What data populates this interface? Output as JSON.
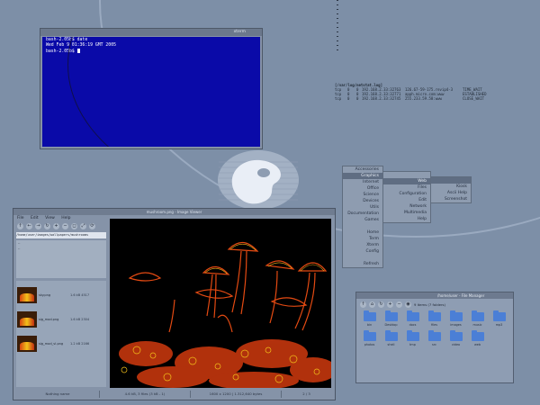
{
  "terminal": {
    "title": "xterm",
    "lines": [
      "bash-2.05b$ date",
      "Wed Feb  9 01:36:19 GMT 2005",
      "bash-2.05b$"
    ]
  },
  "netstat": {
    "header": "[/var/log/netstat.log]",
    "rows": [
      {
        "proto": "tcp",
        "rq": "0",
        "sq": "0",
        "local": "192.168.2.33:32763",
        "foreign": "126.67-59-175.revip4-3",
        "state": "TIME_WAIT"
      },
      {
        "proto": "tcp",
        "rq": "0",
        "sq": "0",
        "local": "192.168.2.33:32771",
        "foreign": "apph.micro.com:www",
        "state": "ESTABLISHED"
      },
      {
        "proto": "tcp",
        "rq": "0",
        "sq": "0",
        "local": "192.168.2.33:32745",
        "foreign": "255.233.59.58:www",
        "state": "CLOSE_WAIT"
      }
    ]
  },
  "menus": {
    "main": [
      "Accessories",
      "Graphics",
      "Internet",
      "Office",
      "Science",
      "Devices",
      "Utils",
      "Documentation",
      "Games",
      "",
      "Home",
      "Term",
      "Xterm",
      "Config",
      "",
      "Refresh"
    ],
    "sub1": [
      "",
      "Web",
      "Files",
      "Configuration",
      "Edit",
      "Network",
      "Multimedia",
      "Help"
    ],
    "sub2": [
      "",
      "Kiosk",
      "Ascii Help",
      "Screenshot"
    ]
  },
  "viewer": {
    "title": "mushroom.png - Image Viewer",
    "menubar": [
      "File",
      "Edit",
      "View",
      "Help"
    ],
    "path": "/home/user/images/wallpapers/mushrooms",
    "dirs": [
      "..",
      ".."
    ],
    "files": [
      {
        "name": "sky.png",
        "size": "1.6 kB 4517"
      },
      {
        "name": "sig_mod.png",
        "size": "1.6 kB 2304"
      },
      {
        "name": "sig_mod_vl.png",
        "size": "1.2 kB 2166"
      }
    ],
    "status": [
      "Nothing name",
      "4.6 kB, 3 files (3 kB - 1)",
      "1600 x 1200 | 1.312,640 bytes",
      "2 / 3"
    ]
  },
  "filemanager": {
    "title": "/home/user - File Manager",
    "info": "9 items (7 folders)",
    "folders": [
      "bin",
      "Desktop",
      "docs",
      "files",
      "images",
      "music",
      "mp3",
      "photos",
      "shell",
      "tmp",
      "src",
      "video",
      "web"
    ]
  },
  "colors": {
    "desktop": "#7d8fa7",
    "terminal_bg": "#0a0aa8",
    "folder": "#4b7fd6"
  }
}
